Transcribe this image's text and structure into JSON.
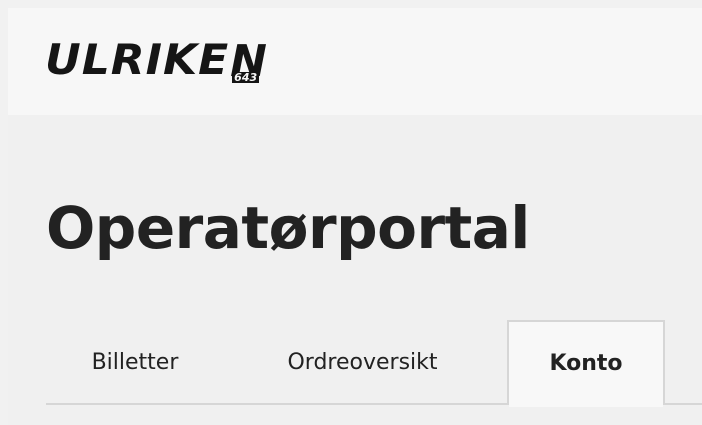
{
  "header": {
    "logo_text": "ULRIKE",
    "logo_last_letter": "N",
    "logo_sub": "643"
  },
  "page": {
    "title": "Operatørportal"
  },
  "tabs": [
    {
      "label": "Billetter",
      "active": false
    },
    {
      "label": "Ordreoversikt",
      "active": false
    },
    {
      "label": "Konto",
      "active": true
    }
  ],
  "colors": {
    "background": "#f0f0f0",
    "header_background": "#f7f7f7",
    "text": "#222222",
    "tab_border": "#d6d6d6"
  }
}
